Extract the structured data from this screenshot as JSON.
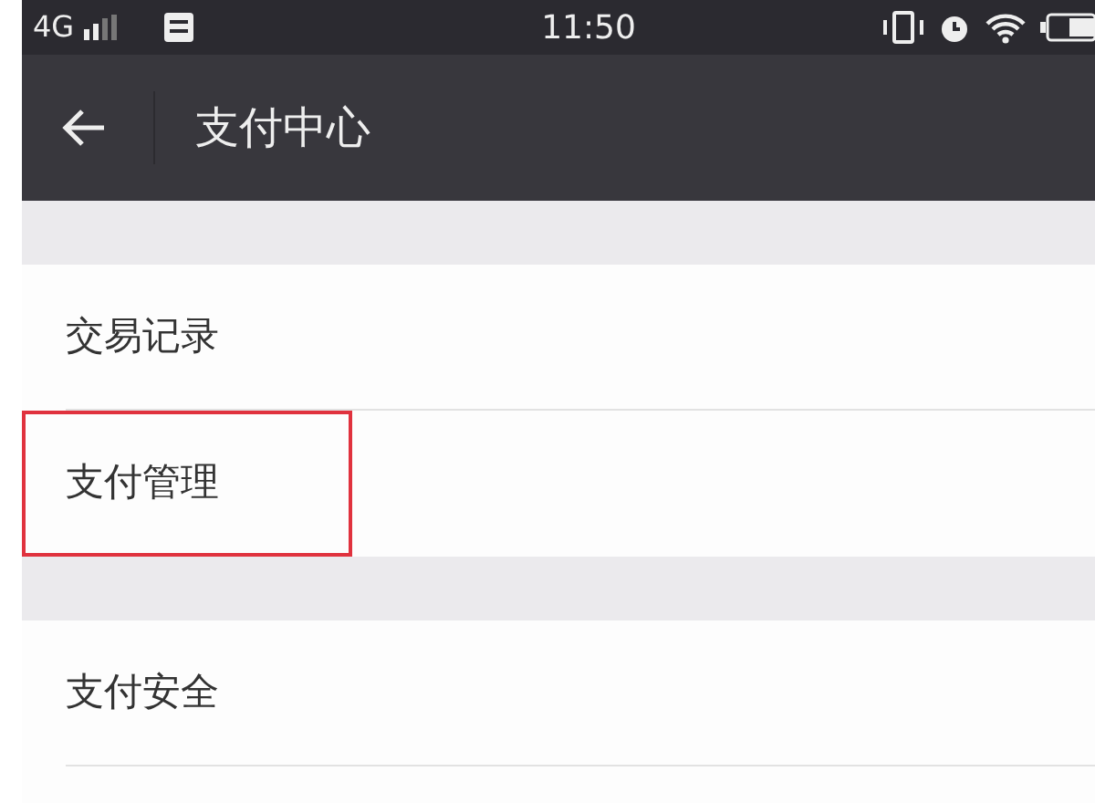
{
  "status_bar": {
    "network": "4G",
    "time": "11:50"
  },
  "header": {
    "title": "支付中心"
  },
  "sections": [
    {
      "items": [
        {
          "label": "交易记录",
          "highlighted": false
        },
        {
          "label": "支付管理",
          "highlighted": true
        }
      ]
    },
    {
      "items": [
        {
          "label": "支付安全",
          "highlighted": false
        }
      ]
    }
  ]
}
